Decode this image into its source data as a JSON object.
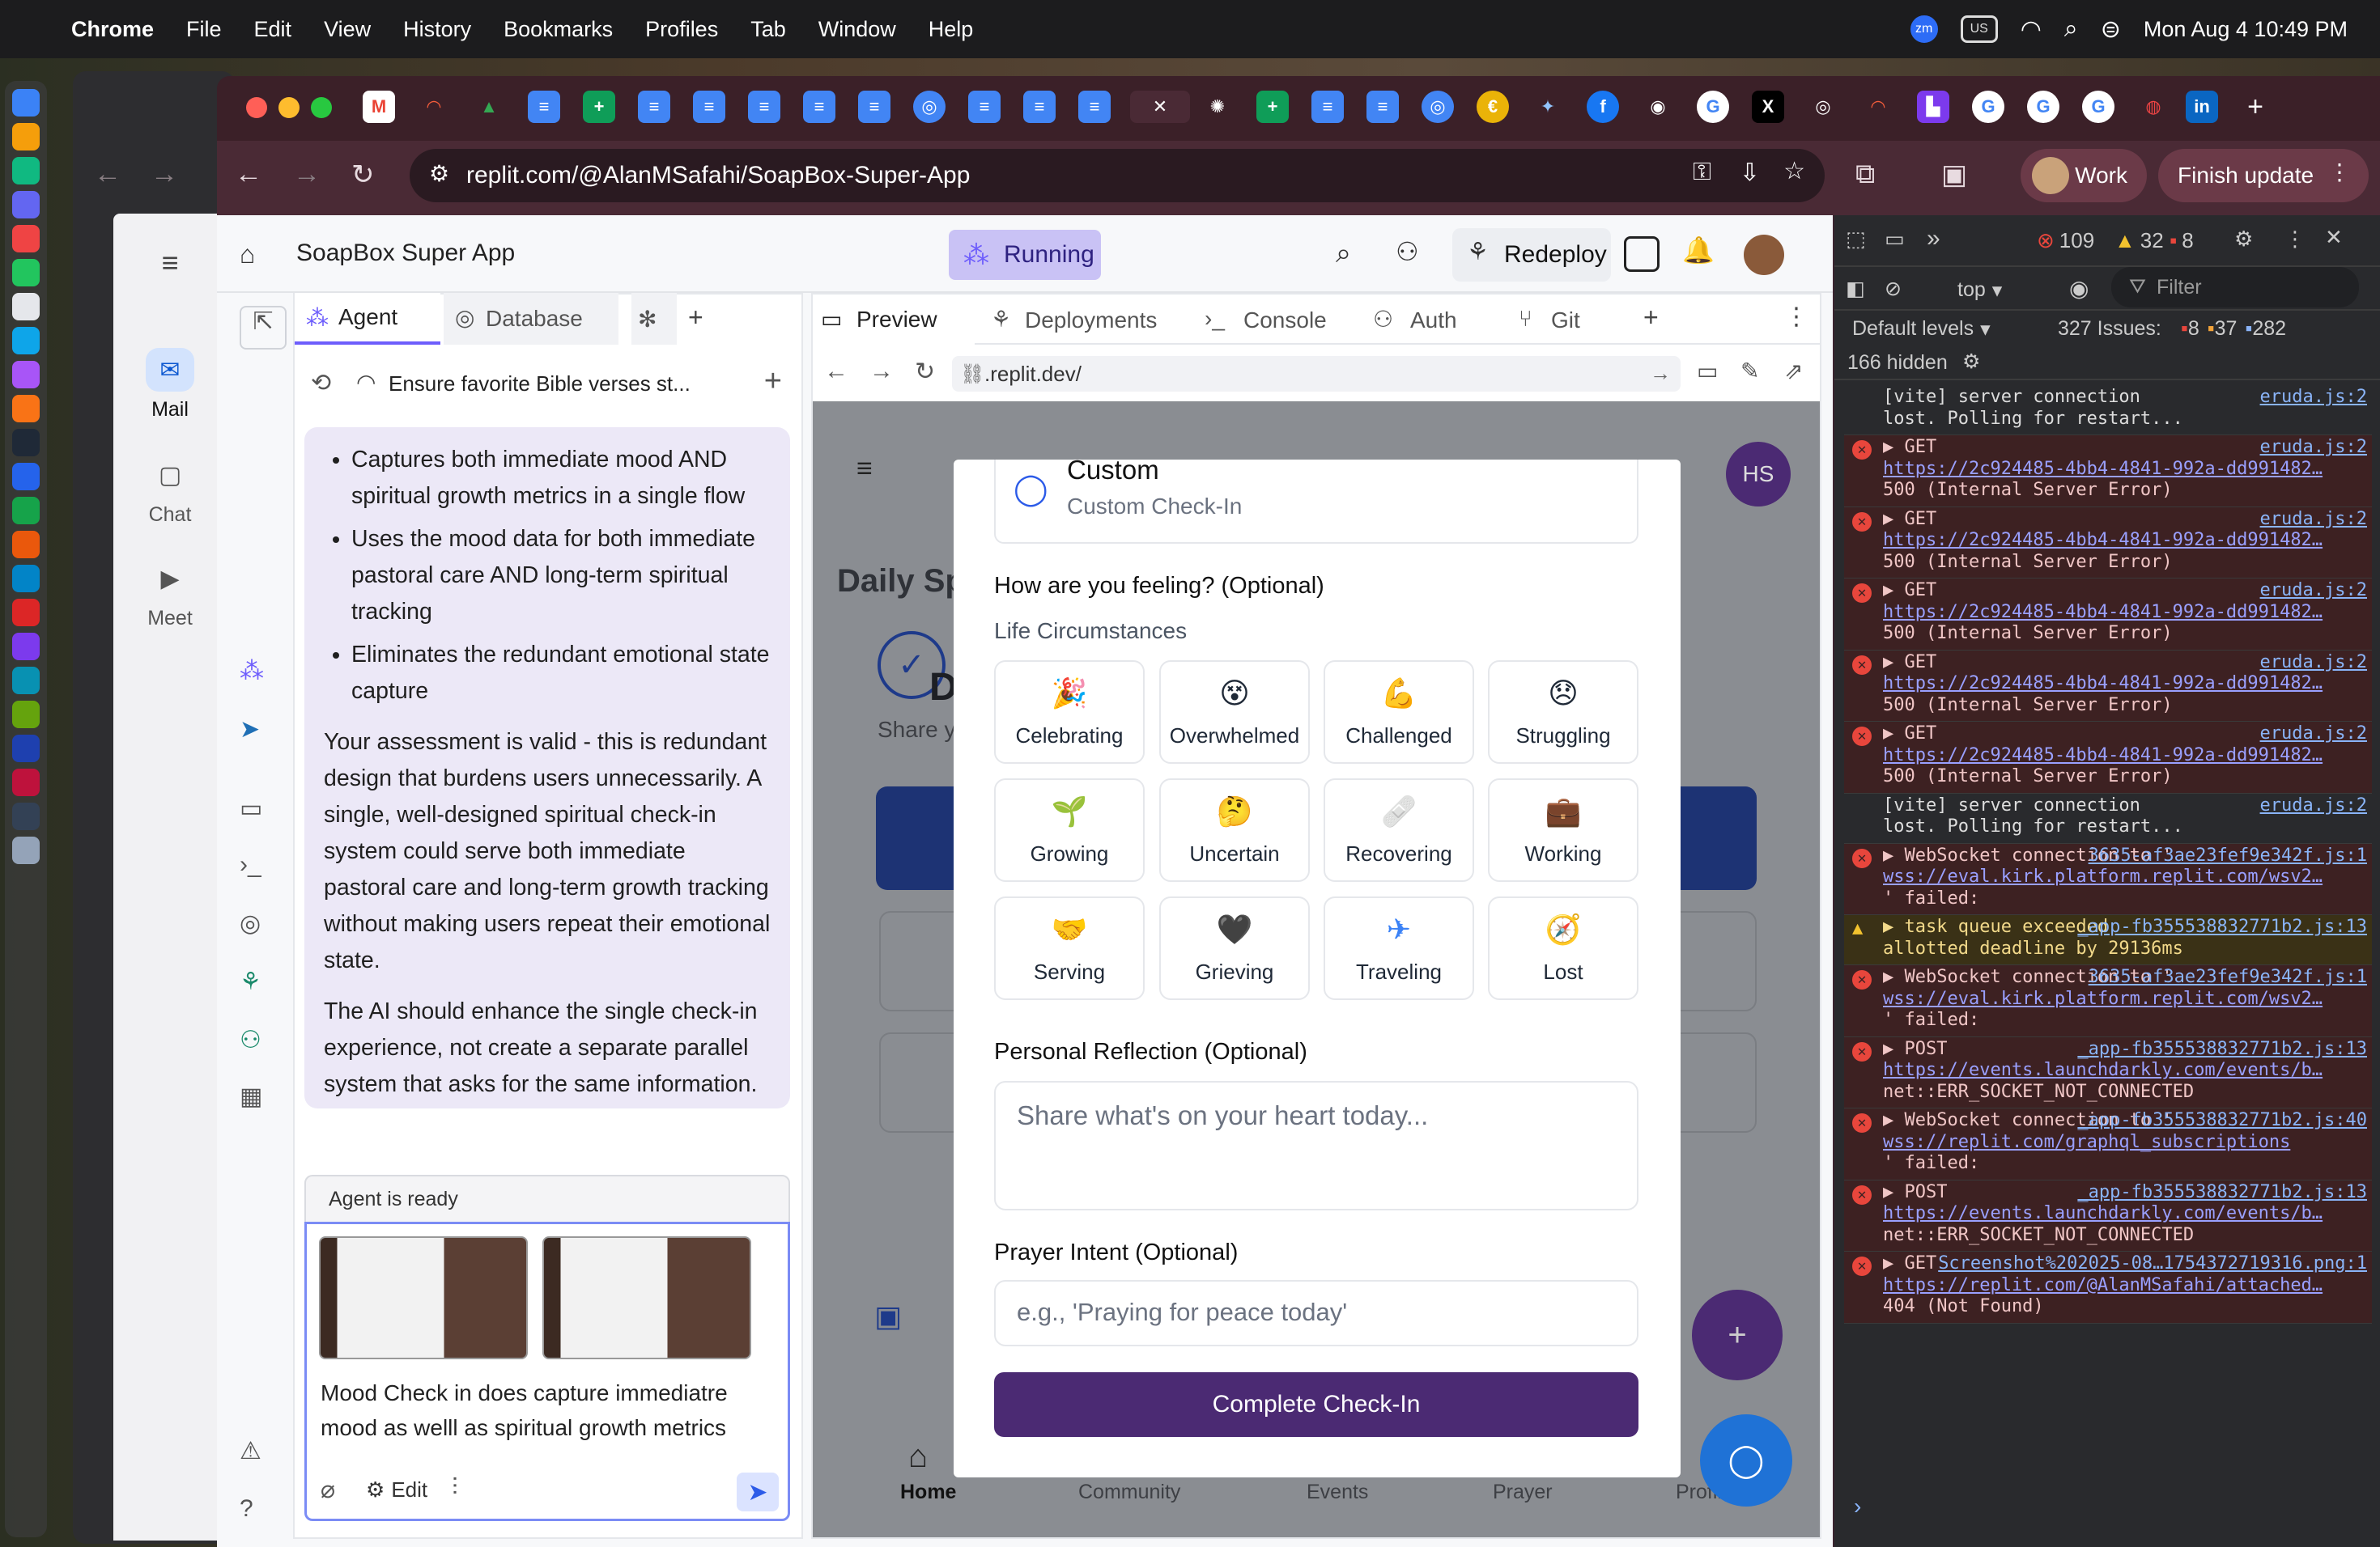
{
  "menubar": {
    "app": "Chrome",
    "items": [
      "File",
      "Edit",
      "View",
      "History",
      "Bookmarks",
      "Profiles",
      "Tab",
      "Window",
      "Help"
    ],
    "status_icons": [
      "zm",
      "US"
    ],
    "clock": "Mon Aug 4  10:49 PM"
  },
  "mail_sidebar": {
    "items": [
      {
        "label": "Mail",
        "icon": "mail-icon"
      },
      {
        "label": "Chat",
        "icon": "chat-icon"
      },
      {
        "label": "Meet",
        "icon": "meet-icon"
      }
    ]
  },
  "browser": {
    "url": "replit.com/@AlanMSafahi/SoapBox-Super-App",
    "profile_label": "Work",
    "update_label": "Finish update"
  },
  "replit": {
    "project_title": "SoapBox Super App",
    "status": "Running",
    "redeploy_label": "Redeploy",
    "left_tabs": [
      "Agent",
      "Database"
    ],
    "chat_title": "Ensure favorite Bible verses st...",
    "chat": {
      "bullets": [
        "Captures both immediate mood AND spiritual growth metrics in a single flow",
        "Uses the mood data for both immediate pastoral care AND long-term spiritual tracking",
        "Eliminates the redundant emotional state capture"
      ],
      "para1": "Your assessment is valid - this is redundant design that burdens users unnecessarily. A single, well-designed spiritual check-in system could serve both immediate pastoral care and long-term growth tracking without making users repeat their emotional state.",
      "para2": "The AI should enhance the single check-in experience, not create a separate parallel system that asks for the same information."
    },
    "agent_status": "Agent is ready",
    "composer_text": "Mood Check in does capture immediatre mood as welll as spiritual growth metrics",
    "composer_edit": "Edit",
    "preview_tabs": [
      "Preview",
      "Deployments",
      "Console",
      "Auth",
      "Git"
    ],
    "preview_url": ".replit.dev/"
  },
  "app": {
    "avatar_initials": "HS",
    "page_heading_partial": "Daily Sp",
    "card_letter": "D",
    "card_sub": "Share y",
    "nav": [
      "Home",
      "Community",
      "Events",
      "Prayer",
      "Profile"
    ],
    "modal": {
      "custom_title": "Custom",
      "custom_sub": "Custom Check-In",
      "feeling_label": "How are you feeling? (Optional)",
      "circumstances_label": "Life Circumstances",
      "moods": [
        {
          "emoji": "🎉",
          "label": "Celebrating"
        },
        {
          "emoji": "😵",
          "label": "Overwhelmed"
        },
        {
          "emoji": "💪",
          "label": "Challenged"
        },
        {
          "emoji": "😞",
          "label": "Struggling"
        },
        {
          "emoji": "🌱",
          "label": "Growing"
        },
        {
          "emoji": "🤔",
          "label": "Uncertain"
        },
        {
          "emoji": "🩹",
          "label": "Recovering"
        },
        {
          "emoji": "💼",
          "label": "Working"
        },
        {
          "emoji": "🤝",
          "label": "Serving"
        },
        {
          "emoji": "🖤",
          "label": "Grieving"
        },
        {
          "emoji": "✈",
          "label": "Traveling"
        },
        {
          "emoji": "🧭",
          "label": "Lost"
        }
      ],
      "reflection_label": "Personal Reflection (Optional)",
      "reflection_placeholder": "Share what's on your heart today...",
      "intent_label": "Prayer Intent (Optional)",
      "intent_placeholder": "e.g., 'Praying for peace today'",
      "complete_label": "Complete Check-In"
    }
  },
  "devtools": {
    "errors_count": "109",
    "warnings_count": "32",
    "info_count": "8",
    "context": "top",
    "filter_placeholder": "Filter",
    "levels": "Default levels",
    "issues_label": "327 Issues:",
    "issues_counts": [
      "8",
      "37",
      "282"
    ],
    "hidden": "166 hidden",
    "logs": [
      {
        "type": "info",
        "text": "[vite] server connection lost. Polling for restart...",
        "src": "eruda.js:2"
      },
      {
        "type": "err",
        "text": "▶ GET",
        "src": "eruda.js:2",
        "link": "https://2c924485-4bb4-4841-992a-dd991482…",
        "tail": "500 (Internal Server Error)"
      },
      {
        "type": "err",
        "text": "▶ GET",
        "src": "eruda.js:2",
        "link": "https://2c924485-4bb4-4841-992a-dd991482…",
        "tail": "500 (Internal Server Error)"
      },
      {
        "type": "err",
        "text": "▶ GET",
        "src": "eruda.js:2",
        "link": "https://2c924485-4bb4-4841-992a-dd991482…",
        "tail": "500 (Internal Server Error)"
      },
      {
        "type": "err",
        "text": "▶ GET",
        "src": "eruda.js:2",
        "link": "https://2c924485-4bb4-4841-992a-dd991482…",
        "tail": "500 (Internal Server Error)"
      },
      {
        "type": "err",
        "text": "▶ GET",
        "src": "eruda.js:2",
        "link": "https://2c924485-4bb4-4841-992a-dd991482…",
        "tail": "500 (Internal Server Error)"
      },
      {
        "type": "info",
        "text": "[vite] server connection lost. Polling for restart...",
        "src": "eruda.js:2"
      },
      {
        "type": "err",
        "text": "▶ WebSocket connection to '",
        "src": "3635-af3ae23fef9e342f.js:1",
        "link": "wss://eval.kirk.platform.replit.com/wsv2…",
        "tail": "' failed:"
      },
      {
        "type": "warn",
        "text": "▶ task queue exceeded allotted deadline by 29136ms",
        "src": "_app-fb355538832771b2.js:13"
      },
      {
        "type": "err",
        "text": "▶ WebSocket connection to '",
        "src": "3635-af3ae23fef9e342f.js:1",
        "link": "wss://eval.kirk.platform.replit.com/wsv2…",
        "tail": "' failed:"
      },
      {
        "type": "err",
        "text": "▶ POST",
        "src": "_app-fb355538832771b2.js:13",
        "link": "https://events.launchdarkly.com/events/b…",
        "tail": "net::ERR_SOCKET_NOT_CONNECTED"
      },
      {
        "type": "err",
        "text": "▶ WebSocket connection to '",
        "src": "_app-fb355538832771b2.js:40",
        "link": "wss://replit.com/graphql_subscriptions",
        "tail": "' failed:"
      },
      {
        "type": "err",
        "text": "▶ POST",
        "src": "_app-fb355538832771b2.js:13",
        "link": "https://events.launchdarkly.com/events/b…",
        "tail": "net::ERR_SOCKET_NOT_CONNECTED"
      },
      {
        "type": "err",
        "text": "▶ GET",
        "src": "Screenshot%202025-08…1754372719316.png:1",
        "link": "https://replit.com/@AlanMSafahi/attached…",
        "tail": "404 (Not Found)"
      }
    ]
  }
}
